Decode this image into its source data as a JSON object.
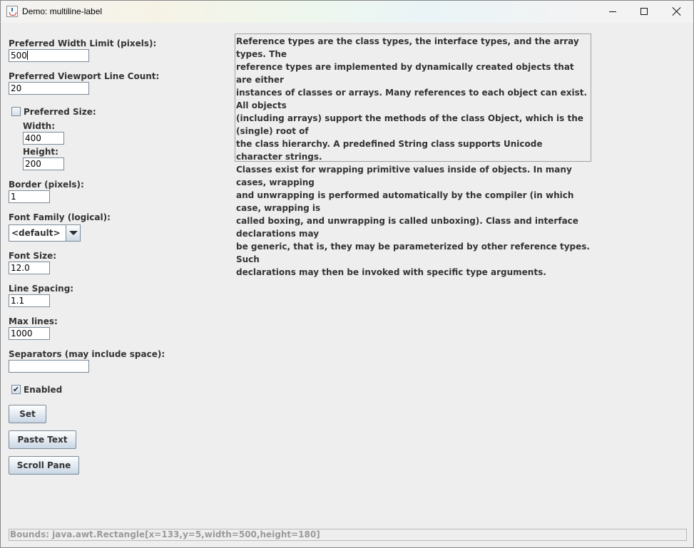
{
  "window": {
    "title": "Demo: multiline-label",
    "icons": {
      "app": "java-cup-icon",
      "minimize": "minimize-icon",
      "maximize": "maximize-icon",
      "close": "close-icon"
    }
  },
  "form": {
    "preferred_width_limit": {
      "label": "Preferred Width Limit (pixels):",
      "value": "500"
    },
    "preferred_viewport_line_count": {
      "label": "Preferred Viewport Line Count:",
      "value": "20"
    },
    "preferred_size": {
      "label": "Preferred Size:",
      "checked": false,
      "width_label": "Width:",
      "width_value": "400",
      "height_label": "Height:",
      "height_value": "200"
    },
    "border": {
      "label": "Border (pixels):",
      "value": "1"
    },
    "font_family": {
      "label": "Font Family (logical):",
      "selected": "<default>"
    },
    "font_size": {
      "label": "Font Size:",
      "value": "12.0"
    },
    "line_spacing": {
      "label": "Line Spacing:",
      "value": "1.1"
    },
    "max_lines": {
      "label": "Max lines:",
      "value": "1000"
    },
    "separators": {
      "label": "Separators (may include space):",
      "value": ""
    },
    "enabled": {
      "label": "Enabled",
      "checked": true,
      "mark": "✔"
    },
    "buttons": {
      "set": "Set",
      "paste_text": "Paste Text",
      "scroll_pane": "Scroll Pane"
    }
  },
  "multiline_label": {
    "lines": [
      "Reference types are the class types, the interface types, and the array types. The",
      "reference types are implemented by dynamically created objects that are either",
      "instances of classes or arrays. Many references to each object can exist. All objects",
      "(including arrays) support the methods of the class Object, which is the (single) root of",
      "the class hierarchy. A predefined String class supports Unicode character strings.",
      "Classes exist for wrapping primitive values inside of objects. In many cases, wrapping",
      "and unwrapping is performed automatically by the compiler (in which case, wrapping is",
      "called boxing, and unwrapping is called unboxing). Class and interface declarations may",
      "be generic, that is, they may be parameterized by other reference types. Such",
      "declarations may then be invoked with specific type arguments."
    ]
  },
  "status_bar": {
    "text": "Bounds: java.awt.Rectangle[x=133,y=5,width=500,height=180]"
  }
}
